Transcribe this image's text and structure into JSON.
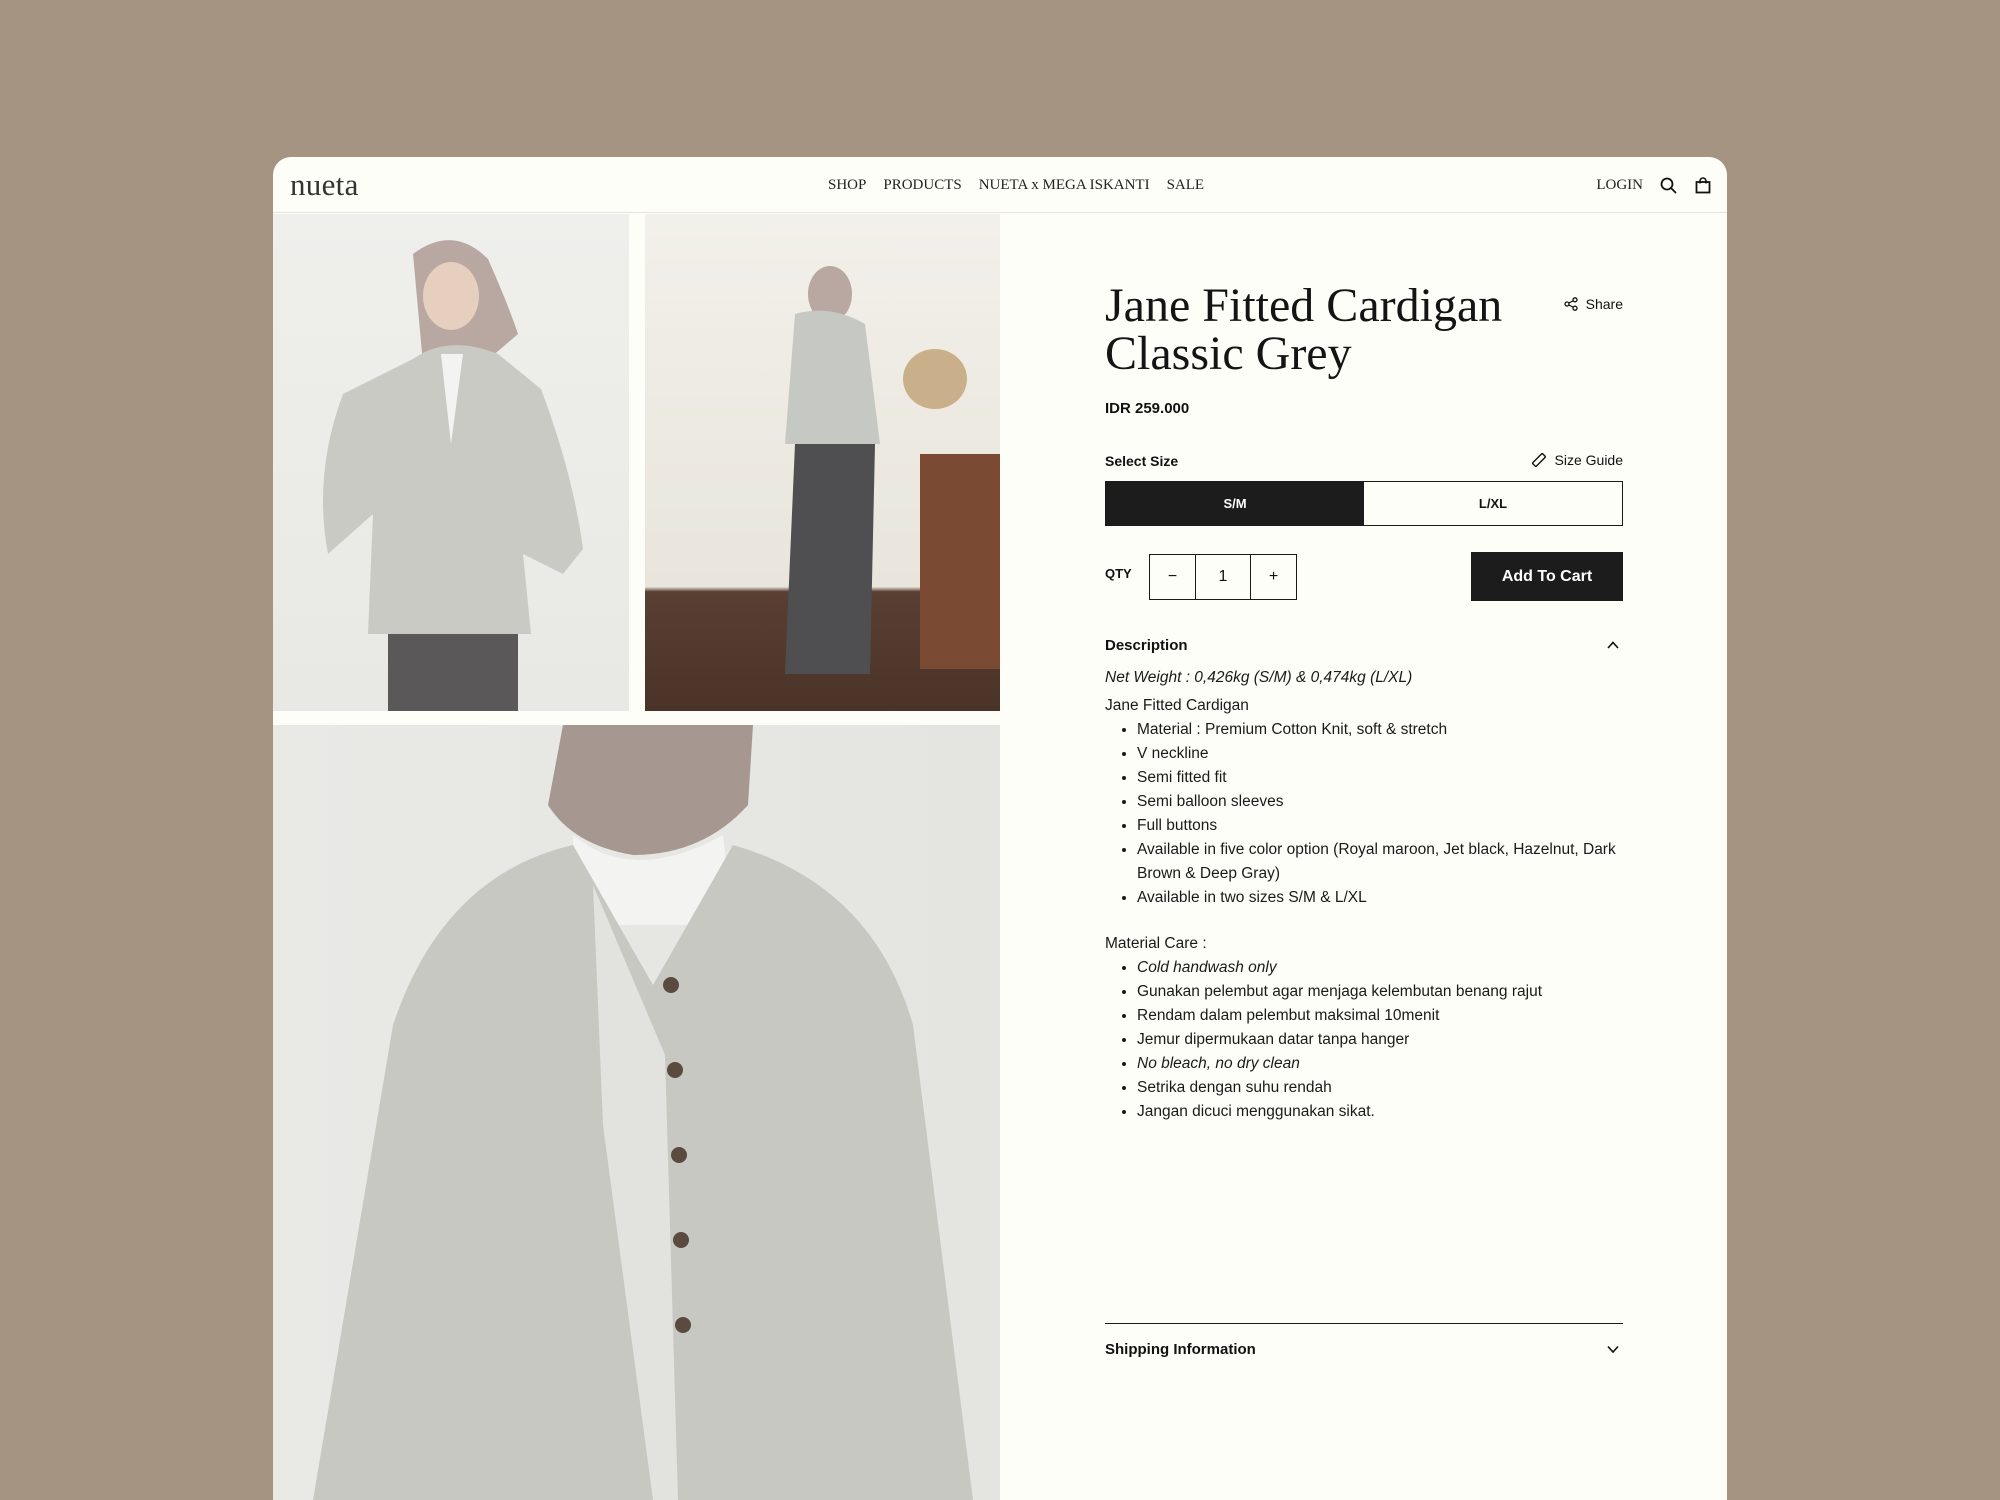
{
  "header": {
    "logo": "nueta",
    "nav": [
      "SHOP",
      "PRODUCTS",
      "NUETA x MEGA ISKANTI",
      "SALE"
    ],
    "login": "LOGIN"
  },
  "icons": {
    "search": "search-icon",
    "cart": "shopping-bag-icon",
    "share": "share-icon",
    "size_guide": "ruler-icon",
    "collapse": "chevron-up-icon",
    "expand": "chevron-down-icon"
  },
  "product": {
    "title": "Jane Fitted Cardigan Classic Grey",
    "share_label": "Share",
    "price": "IDR 259.000",
    "select_size_label": "Select Size",
    "size_guide_label": "Size Guide",
    "sizes": [
      "S/M",
      "L/XL"
    ],
    "selected_size": "S/M",
    "qty_label": "QTY",
    "qty_minus": "−",
    "qty_value": "1",
    "qty_plus": "+",
    "add_to_cart": "Add To Cart"
  },
  "description": {
    "heading": "Description",
    "net_weight": "Net Weight : 0,426kg (S/M) & 0,474kg (L/XL)",
    "product_name": "Jane Fitted Cardigan",
    "features": [
      "Material : Premium Cotton Knit, soft & stretch",
      "V neckline",
      "Semi fitted fit",
      "Semi balloon sleeves",
      "Full buttons",
      "Available in five color option (Royal maroon, Jet black, Hazelnut, Dark Brown & Deep Gray)",
      "Available in two sizes S/M & L/XL"
    ],
    "care_heading": "Material Care :",
    "care": [
      "Cold handwash only",
      "Gunakan pelembut agar menjaga kelembutan benang rajut",
      "Rendam dalam pelembut maksimal 10menit",
      "Jemur dipermukaan datar tanpa hanger",
      "No bleach, no dry clean",
      "Setrika dengan suhu rendah",
      "Jangan dicuci menggunakan sikat."
    ]
  },
  "shipping": {
    "heading": "Shipping Information"
  },
  "colors": {
    "page_background": "#a69483",
    "window_background": "#fefef8",
    "primary_dark": "#1c1c1c"
  }
}
